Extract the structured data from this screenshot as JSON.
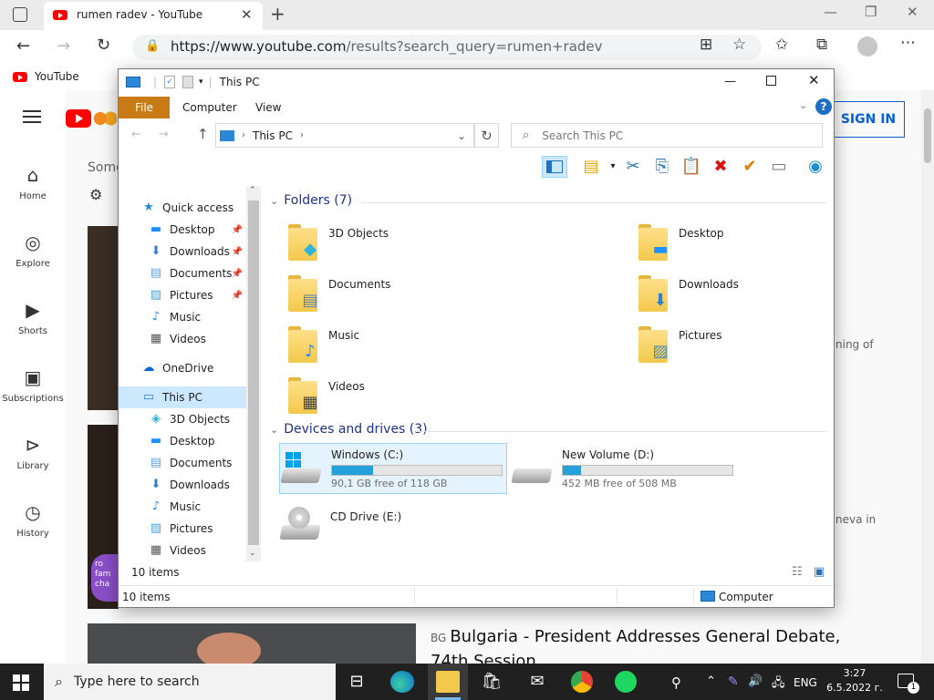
{
  "browser": {
    "tab_title": "rumen radev - YouTube",
    "url_main": "https://www.youtube.com",
    "url_rest": "/results?search_query=rumen+radev",
    "favorite_label": "YouTube"
  },
  "youtube": {
    "signin_label": "SIGN IN",
    "search_hint": "Some",
    "nav": [
      {
        "label": "Home",
        "icon": "home-icon"
      },
      {
        "label": "Explore",
        "icon": "compass-icon"
      },
      {
        "label": "Shorts",
        "icon": "shorts-icon"
      },
      {
        "label": "Subscriptions",
        "icon": "subscriptions-icon"
      },
      {
        "label": "Library",
        "icon": "library-icon"
      },
      {
        "label": "History",
        "icon": "history-icon"
      }
    ],
    "snippet1": "ning of",
    "snippet2": "neva in",
    "channel_badge": "ro fam cha",
    "video_badge": "BG",
    "video_title": "Bulgaria - President Addresses General Debate, 74th Session"
  },
  "explorer": {
    "title": "This PC",
    "ribbon_tabs": [
      "File",
      "Computer",
      "View"
    ],
    "address": "This PC",
    "search_placeholder": "Search This PC",
    "nav_items": [
      {
        "label": "Quick access",
        "icon": "star-icon",
        "color": "#2b88d8",
        "pinned": false,
        "indent": 0
      },
      {
        "label": "Desktop",
        "icon": "desktop-icon",
        "color": "#1e90ff",
        "pinned": true,
        "indent": 1
      },
      {
        "label": "Downloads",
        "icon": "downloads-icon",
        "color": "#2f7fd1",
        "pinned": true,
        "indent": 1
      },
      {
        "label": "Documents",
        "icon": "documents-icon",
        "color": "#5aa0e0",
        "pinned": true,
        "indent": 1
      },
      {
        "label": "Pictures",
        "icon": "pictures-icon",
        "color": "#4aa3df",
        "pinned": true,
        "indent": 1
      },
      {
        "label": "Music",
        "icon": "music-icon",
        "color": "#1e90ff",
        "pinned": false,
        "indent": 1
      },
      {
        "label": "Videos",
        "icon": "videos-icon",
        "color": "#555",
        "pinned": false,
        "indent": 1
      },
      {
        "label": "OneDrive",
        "icon": "onedrive-icon",
        "color": "#0a64d6",
        "pinned": false,
        "indent": 0
      },
      {
        "label": "This PC",
        "icon": "pc-icon",
        "color": "#2b88d8",
        "pinned": false,
        "indent": 0,
        "selected": true
      },
      {
        "label": "3D Objects",
        "icon": "3d-objects-icon",
        "color": "#2fb3d6",
        "pinned": false,
        "indent": 1
      },
      {
        "label": "Desktop",
        "icon": "desktop-icon",
        "color": "#1e90ff",
        "pinned": false,
        "indent": 1
      },
      {
        "label": "Documents",
        "icon": "documents-icon",
        "color": "#5aa0e0",
        "pinned": false,
        "indent": 1
      },
      {
        "label": "Downloads",
        "icon": "downloads-icon",
        "color": "#2f7fd1",
        "pinned": false,
        "indent": 1
      },
      {
        "label": "Music",
        "icon": "music-icon",
        "color": "#1e90ff",
        "pinned": false,
        "indent": 1
      },
      {
        "label": "Pictures",
        "icon": "pictures-icon",
        "color": "#4aa3df",
        "pinned": false,
        "indent": 1
      },
      {
        "label": "Videos",
        "icon": "videos-icon",
        "color": "#555",
        "pinned": false,
        "indent": 1
      }
    ],
    "folders_header": "Folders (7)",
    "folders": [
      {
        "name": "3D Objects",
        "icon": "3d-objects-icon"
      },
      {
        "name": "Desktop",
        "icon": "desktop-icon"
      },
      {
        "name": "Documents",
        "icon": "documents-icon"
      },
      {
        "name": "Downloads",
        "icon": "downloads-icon"
      },
      {
        "name": "Music",
        "icon": "music-icon"
      },
      {
        "name": "Pictures",
        "icon": "pictures-icon"
      },
      {
        "name": "Videos",
        "icon": "videos-icon"
      }
    ],
    "drives_header": "Devices and drives (3)",
    "drives": [
      {
        "name": "Windows (C:)",
        "free": "90,1 GB free of 118 GB",
        "used_fraction": 0.24,
        "icon": "windows-drive-icon",
        "selected": true
      },
      {
        "name": "New Volume (D:)",
        "free": "452 MB free of 508 MB",
        "used_fraction": 0.11,
        "icon": "drive-icon",
        "selected": false
      },
      {
        "name": "CD Drive (E:)",
        "free": "",
        "used_fraction": null,
        "icon": "cd-drive-icon",
        "selected": false
      }
    ],
    "item_count": "10 items",
    "status_count": "10 items",
    "status_location": "Computer"
  },
  "taskbar": {
    "search_placeholder": "Type here to search",
    "language": "ENG",
    "time": "3:27",
    "date": "6.5.2022 г.",
    "notification_count": "1"
  }
}
